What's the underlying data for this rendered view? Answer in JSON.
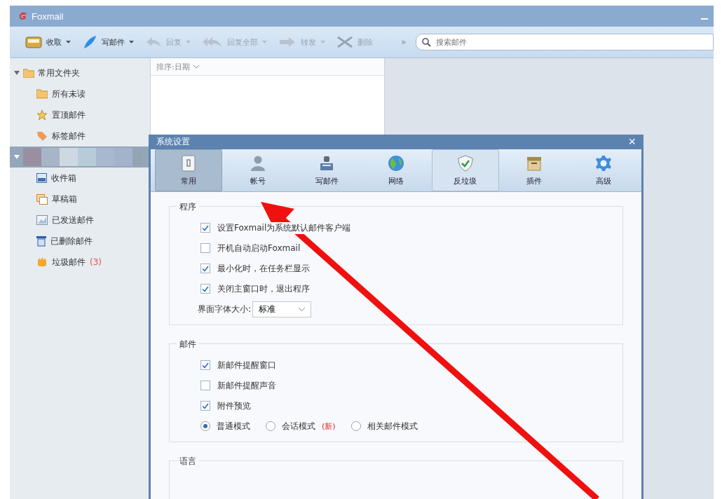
{
  "window": {
    "title": "Foxmail"
  },
  "toolbar": [
    {
      "label": "收取",
      "disabled": false,
      "dropdown": true
    },
    {
      "label": "写邮件",
      "disabled": false,
      "dropdown": true
    },
    {
      "label": "回复",
      "disabled": true,
      "dropdown": true
    },
    {
      "label": "回复全部",
      "disabled": true,
      "dropdown": true
    },
    {
      "label": "转发",
      "disabled": true,
      "dropdown": true
    },
    {
      "label": "删除",
      "disabled": true,
      "dropdown": false
    }
  ],
  "toolbar_more": "»",
  "search": {
    "placeholder": "搜索邮件"
  },
  "sidebar": {
    "groups": [
      {
        "label": "常用文件夹",
        "expanded": true,
        "selected": false,
        "children": [
          {
            "label": "所有未读"
          },
          {
            "label": "置顶邮件"
          },
          {
            "label": "标签邮件"
          }
        ]
      },
      {
        "expanded": true,
        "selected": true,
        "children": [
          {
            "label": "收件箱"
          },
          {
            "label": "草稿箱"
          },
          {
            "label": "已发送邮件"
          },
          {
            "label": "已删除邮件"
          },
          {
            "label": "垃圾邮件",
            "count": "(3)"
          }
        ]
      }
    ]
  },
  "mail_list": {
    "sort": "排序:日期"
  },
  "dialog": {
    "title": "系统设置",
    "close": "×",
    "tabs": [
      {
        "label": "常用",
        "selected": true,
        "hovered": false
      },
      {
        "label": "帐号",
        "selected": false,
        "hovered": false
      },
      {
        "label": "写邮件",
        "selected": false,
        "hovered": false
      },
      {
        "label": "网络",
        "selected": false,
        "hovered": false
      },
      {
        "label": "反垃圾",
        "selected": false,
        "hovered": true
      },
      {
        "label": "插件",
        "selected": false,
        "hovered": false
      },
      {
        "label": "高级",
        "selected": false,
        "hovered": false
      }
    ],
    "sections": [
      {
        "title": "程序",
        "items": [
          {
            "kind": "checkbox",
            "label": "设置Foxmail为系统默认邮件客户端",
            "checked": true
          },
          {
            "kind": "checkbox",
            "label": "开机自动启动Foxmail",
            "checked": false
          },
          {
            "kind": "checkbox",
            "label": "最小化时，在任务栏显示",
            "checked": true
          },
          {
            "kind": "checkbox",
            "label": "关闭主窗口时，退出程序",
            "checked": true
          },
          {
            "kind": "select",
            "label": "界面字体大小:",
            "value": "标准"
          }
        ]
      },
      {
        "title": "邮件",
        "items": [
          {
            "kind": "checkbox",
            "label": "新邮件提醒窗口",
            "checked": true
          },
          {
            "kind": "checkbox",
            "label": "新邮件提醒声音",
            "checked": false
          },
          {
            "kind": "checkbox",
            "label": "附件预览",
            "checked": true
          },
          {
            "kind": "radios",
            "options": [
              {
                "label": "普通模式",
                "selected": true
              },
              {
                "label": "会话模式",
                "badge": "(新)",
                "selected": false
              },
              {
                "label": "相关邮件模式",
                "selected": false
              }
            ]
          }
        ]
      },
      {
        "title": "语言"
      }
    ]
  }
}
